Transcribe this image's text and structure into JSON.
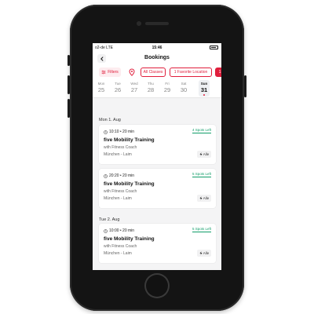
{
  "status_bar": {
    "carrier": "o2-de  LTE",
    "time": "15:46"
  },
  "header": {
    "title": "Bookings"
  },
  "filters": {
    "filters_label": "Filters",
    "chips": [
      "All Classes",
      "1 Favorite Location",
      "1"
    ]
  },
  "days": [
    {
      "name": "Mon",
      "num": "25"
    },
    {
      "name": "Tue",
      "num": "26"
    },
    {
      "name": "Wed",
      "num": "27"
    },
    {
      "name": "Thu",
      "num": "28"
    },
    {
      "name": "Fri",
      "num": "29"
    },
    {
      "name": "Sat",
      "num": "30"
    },
    {
      "name": "Sun",
      "num": "31"
    }
  ],
  "selected_day": "Sun 31",
  "sections": [
    "Mon 1. Aug",
    "Tue 2. Aug"
  ],
  "cards": [
    {
      "time": "10:10 • 20 min",
      "spots": "4 Spots Left",
      "title": "five Mobility Training",
      "coach": "with Fitness Coach",
      "location": "München - Laim",
      "tag": "Alle"
    },
    {
      "time": "20:20 • 20 min",
      "spots": "5 Spots Left",
      "title": "five Mobility Training",
      "coach": "with Fitness Coach",
      "location": "München - Laim",
      "tag": "Alle"
    },
    {
      "time": "10:00 • 20 min",
      "spots": "5 Spots Left",
      "title": "five Mobility Training",
      "coach": "with Fitness Coach",
      "location": "München - Laim",
      "tag": "Alle"
    }
  ],
  "colors": {
    "accent": "#e01e3c",
    "spots": "#0f9d68",
    "phone": "#141414"
  },
  "icons": [
    "back-icon",
    "filters-icon",
    "location-pin-icon",
    "clock-icon",
    "bolt-icon",
    "battery-icon"
  ]
}
